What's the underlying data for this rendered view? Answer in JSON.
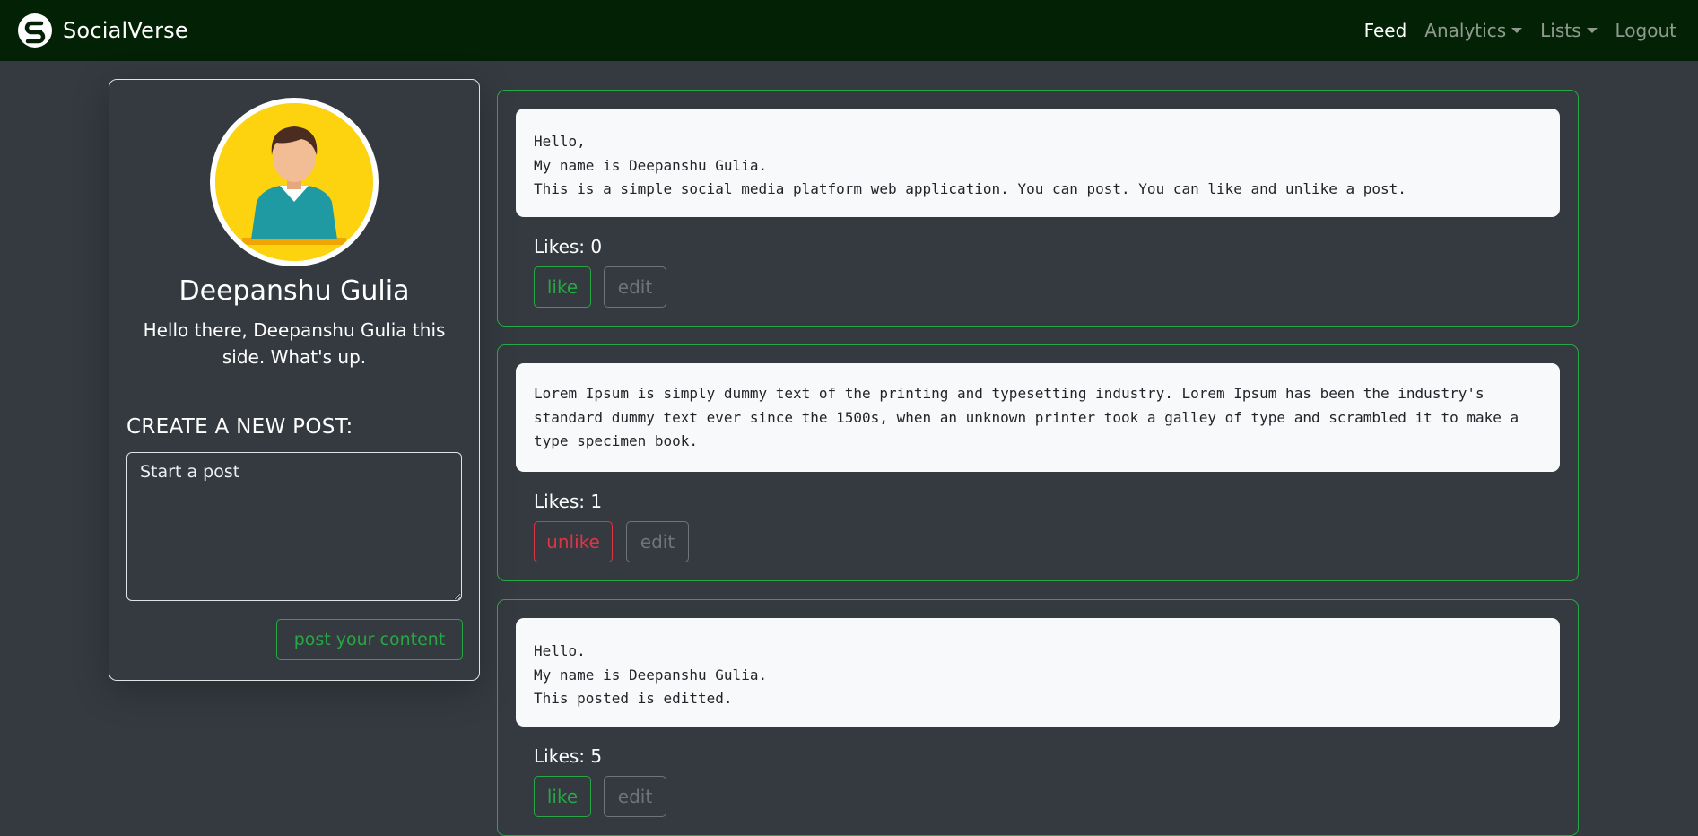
{
  "nav": {
    "brand": "SocialVerse",
    "links": {
      "feed": "Feed",
      "analytics": "Analytics",
      "lists": "Lists",
      "logout": "Logout"
    }
  },
  "profile": {
    "name": "Deepanshu Gulia",
    "bio": "Hello there, Deepanshu Gulia this side. What's up.",
    "create_heading": "CREATE A NEW POST:",
    "textarea_placeholder": "Start a post",
    "post_button": "post your content"
  },
  "posts": [
    {
      "content": "Hello,\nMy name is Deepanshu Gulia.\nThis is a simple social media platform web application. You can post. You can like and unlike a post.",
      "likes": "Likes: 0",
      "action": "like",
      "edit": "edit"
    },
    {
      "content": "Lorem Ipsum is simply dummy text of the printing and typesetting industry. Lorem Ipsum has been the industry's standard dummy text ever since the 1500s, when an unknown printer took a galley of type and scrambled it to make a type specimen book.",
      "likes": "Likes: 1",
      "action": "unlike",
      "edit": "edit"
    },
    {
      "content": "Hello.\nMy name is Deepanshu Gulia.\nThis posted is editted.",
      "likes": "Likes: 5",
      "action": "like",
      "edit": "edit"
    }
  ],
  "colors": {
    "navbar": "#032104",
    "background": "#343a40",
    "success": "#28a745",
    "danger": "#dc3545",
    "secondary": "#6c757d",
    "avatar_bg": "#fdd30f"
  }
}
